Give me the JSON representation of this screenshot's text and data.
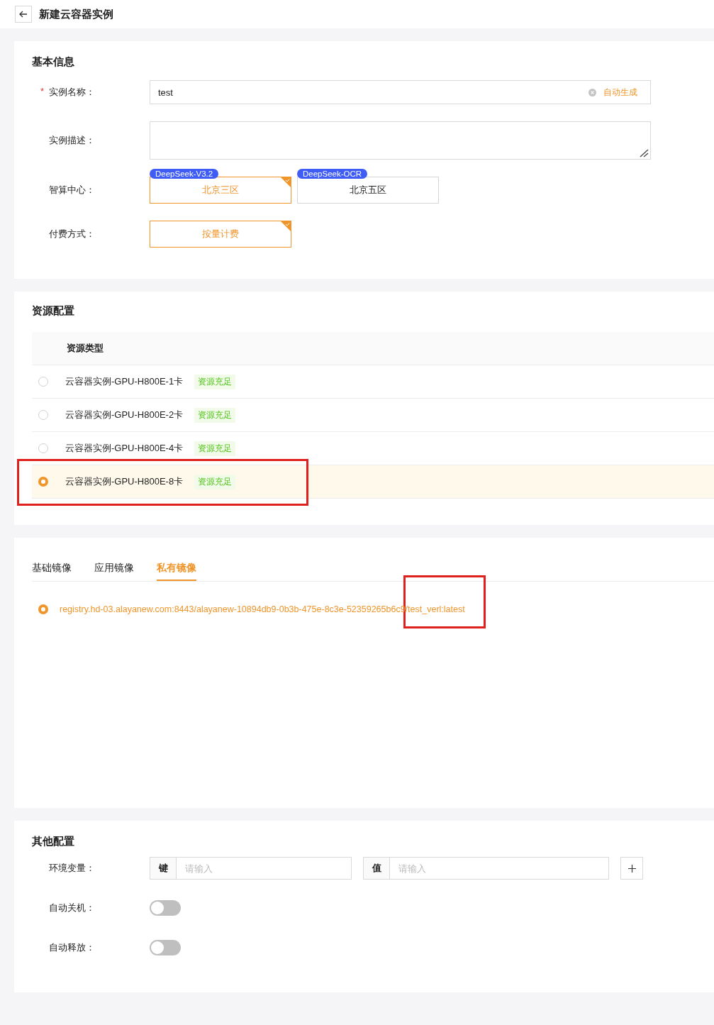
{
  "header": {
    "title": "新建云容器实例"
  },
  "basic_info": {
    "title": "基本信息",
    "fields": [
      {
        "kind": "text",
        "label": "实例名称：",
        "required_mark": "*",
        "value": "test",
        "action": "自动生成"
      },
      {
        "kind": "textarea",
        "label": "实例描述："
      },
      {
        "kind": "choice",
        "label": "智算中心：",
        "options": [
          {
            "badge": "DeepSeek-V3.2",
            "label": "北京三区",
            "selected": true
          },
          {
            "badge": "DeepSeek-OCR",
            "label": "北京五区",
            "selected": false
          }
        ]
      },
      {
        "kind": "choice",
        "label": "付费方式：",
        "options": [
          {
            "label": "按量计费",
            "selected": true
          }
        ]
      }
    ]
  },
  "resources": {
    "title": "资源配置",
    "column": "资源类型",
    "rows": [
      {
        "name": "云容器实例-GPU-H800E-1卡",
        "status": "资源充足",
        "selected": false,
        "highlighted": false
      },
      {
        "name": "云容器实例-GPU-H800E-2卡",
        "status": "资源充足",
        "selected": false,
        "highlighted": false
      },
      {
        "name": "云容器实例-GPU-H800E-4卡",
        "status": "资源充足",
        "selected": false,
        "highlighted": false
      },
      {
        "name": "云容器实例-GPU-H800E-8卡",
        "status": "资源充足",
        "selected": true,
        "highlighted": true
      }
    ]
  },
  "images": {
    "tabs": [
      {
        "label": "基础镜像",
        "selected": false
      },
      {
        "label": "应用镜像",
        "selected": false
      },
      {
        "label": "私有镜像",
        "selected": true
      }
    ],
    "items": [
      {
        "value": "registry.hd-03.alayanew.com:8443/alayanew-10894db9-0b3b-475e-8c3e-52359265b6c9/test_verl:latest",
        "selected": true,
        "highlighted": true
      }
    ]
  },
  "other": {
    "title": "其他配置",
    "env": {
      "label": "环境变量：",
      "key_addon": "键",
      "key_placeholder": "请输入",
      "value_addon": "值",
      "value_placeholder": "请输入"
    },
    "toggles": [
      {
        "label": "自动关机：",
        "on": false
      },
      {
        "label": "自动释放：",
        "on": false
      }
    ]
  }
}
